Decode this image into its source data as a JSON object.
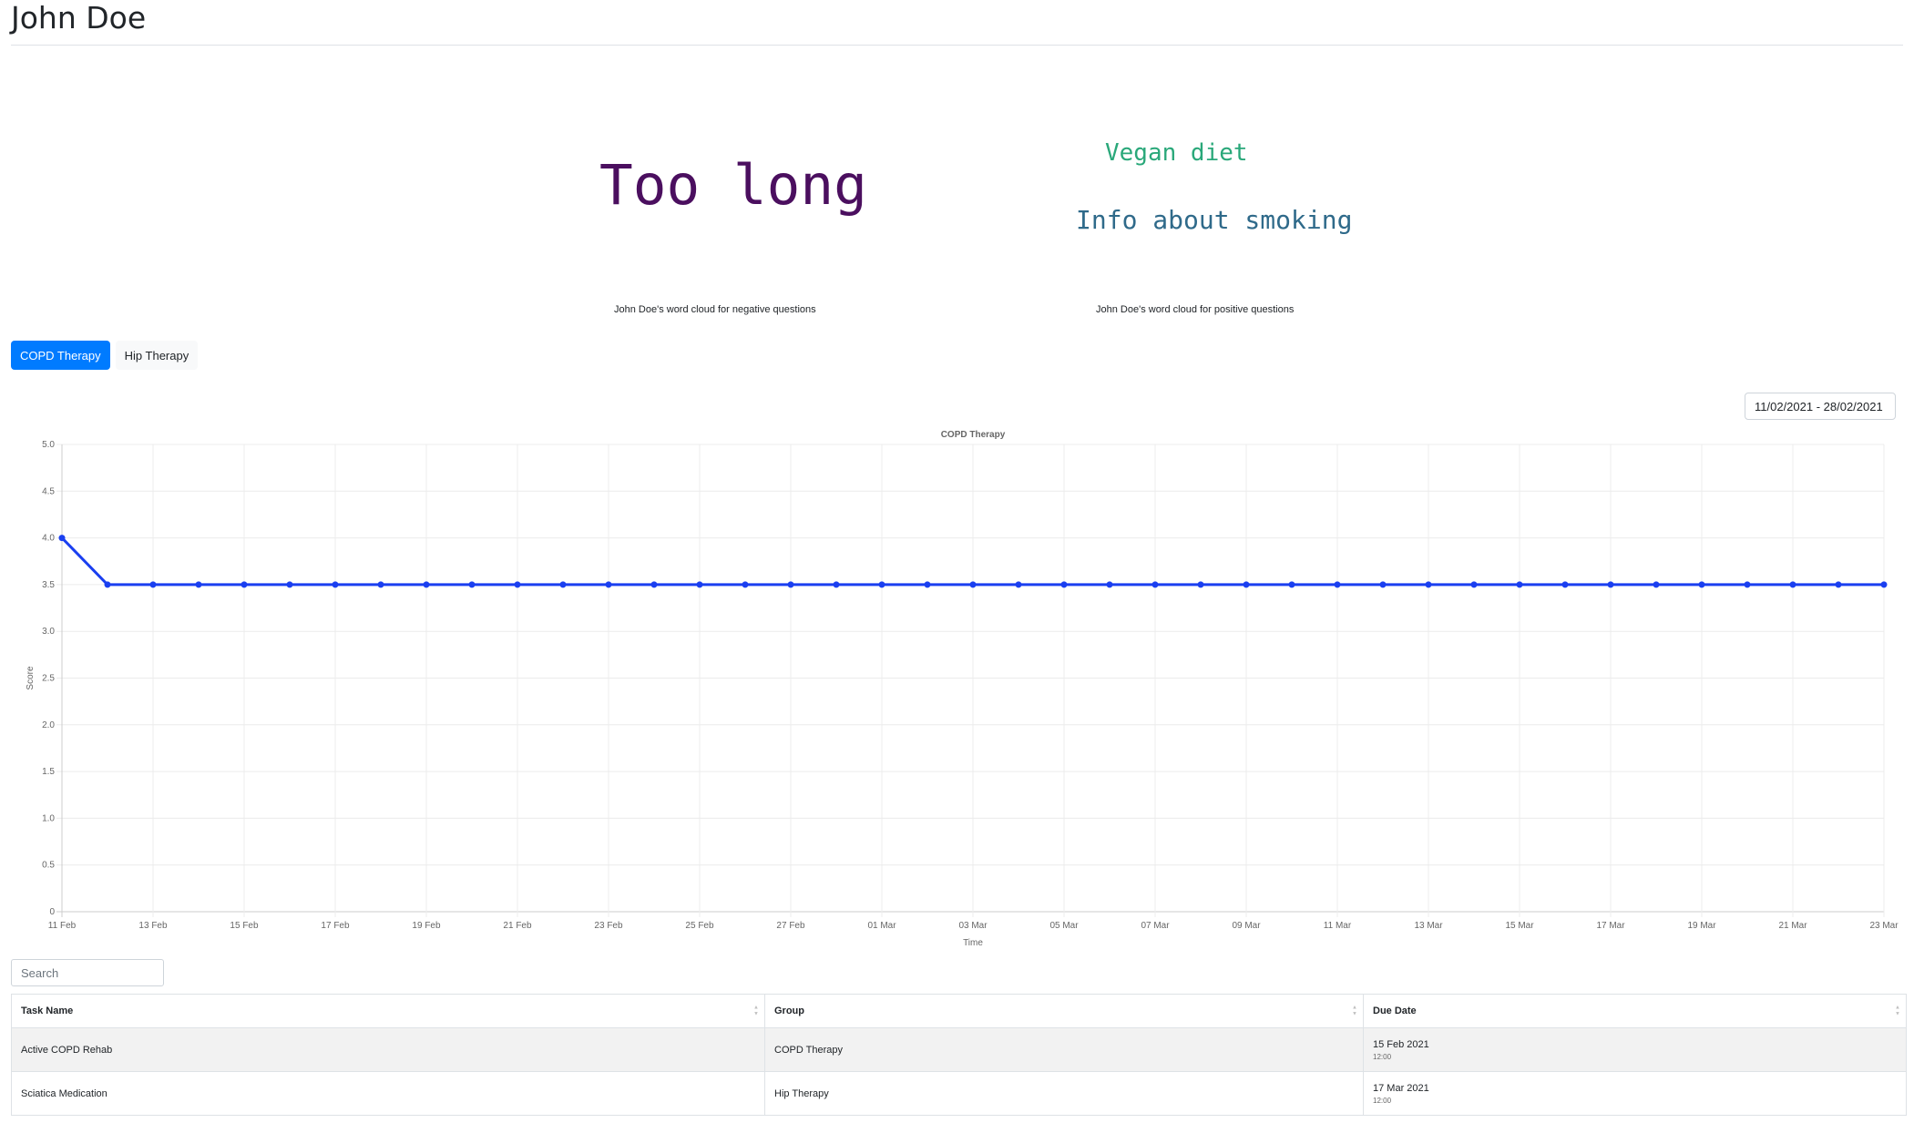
{
  "header": {
    "title": "John Doe"
  },
  "word_clouds": {
    "negative": {
      "caption": "John Doe's word cloud for negative questions",
      "words": [
        {
          "text": "Too long",
          "color": "#4b0f5f"
        }
      ]
    },
    "positive": {
      "caption": "John Doe's word cloud for positive questions",
      "words": [
        {
          "text": "Vegan diet",
          "color": "#2aa87a"
        },
        {
          "text": "Info about smoking",
          "color": "#2f6a8a"
        }
      ]
    }
  },
  "tabs": [
    {
      "label": "COPD Therapy",
      "active": true
    },
    {
      "label": "Hip Therapy",
      "active": false
    }
  ],
  "date_range": "11/02/2021 - 28/02/2021",
  "chart_data": {
    "type": "line",
    "title": "COPD Therapy",
    "xlabel": "Time",
    "ylabel": "Score",
    "ylim": [
      0,
      5
    ],
    "yticks": [
      "0",
      "0.5",
      "1.0",
      "1.5",
      "2.0",
      "2.5",
      "3.0",
      "3.5",
      "4.0",
      "4.5",
      "5.0"
    ],
    "x": [
      "11 Feb",
      "12 Feb",
      "13 Feb",
      "14 Feb",
      "15 Feb",
      "16 Feb",
      "17 Feb",
      "18 Feb",
      "19 Feb",
      "20 Feb",
      "21 Feb",
      "22 Feb",
      "23 Feb",
      "24 Feb",
      "25 Feb",
      "26 Feb",
      "27 Feb",
      "28 Feb",
      "01 Mar",
      "02 Mar",
      "03 Mar",
      "04 Mar",
      "05 Mar",
      "06 Mar",
      "07 Mar",
      "08 Mar",
      "09 Mar",
      "10 Mar",
      "11 Mar",
      "12 Mar",
      "13 Mar",
      "14 Mar",
      "15 Mar",
      "16 Mar",
      "17 Mar",
      "18 Mar",
      "19 Mar",
      "20 Mar",
      "21 Mar",
      "22 Mar",
      "23 Mar"
    ],
    "xticks": [
      "11 Feb",
      "13 Feb",
      "15 Feb",
      "17 Feb",
      "19 Feb",
      "21 Feb",
      "23 Feb",
      "25 Feb",
      "27 Feb",
      "01 Mar",
      "03 Mar",
      "05 Mar",
      "07 Mar",
      "09 Mar",
      "11 Mar",
      "13 Mar",
      "15 Mar",
      "17 Mar",
      "19 Mar",
      "21 Mar",
      "23 Mar"
    ],
    "series": [
      {
        "values": [
          4.0,
          3.5,
          3.5,
          3.5,
          3.5,
          3.5,
          3.5,
          3.5,
          3.5,
          3.5,
          3.5,
          3.5,
          3.5,
          3.5,
          3.5,
          3.5,
          3.5,
          3.5,
          3.5,
          3.5,
          3.5,
          3.5,
          3.5,
          3.5,
          3.5,
          3.5,
          3.5,
          3.5,
          3.5,
          3.5,
          3.5,
          3.5,
          3.5,
          3.5,
          3.5,
          3.5,
          3.5,
          3.5,
          3.5,
          3.5,
          3.5
        ]
      }
    ],
    "grid": true,
    "line_color": "#1a3ff0"
  },
  "search": {
    "placeholder": "Search"
  },
  "table": {
    "headers": [
      "Task Name",
      "Group",
      "Due Date"
    ],
    "rows": [
      {
        "task": "Active COPD Rehab",
        "group": "COPD Therapy",
        "date": "15 Feb 2021",
        "time": "12:00"
      },
      {
        "task": "Sciatica Medication",
        "group": "Hip Therapy",
        "date": "17 Mar 2021",
        "time": "12:00"
      }
    ]
  }
}
